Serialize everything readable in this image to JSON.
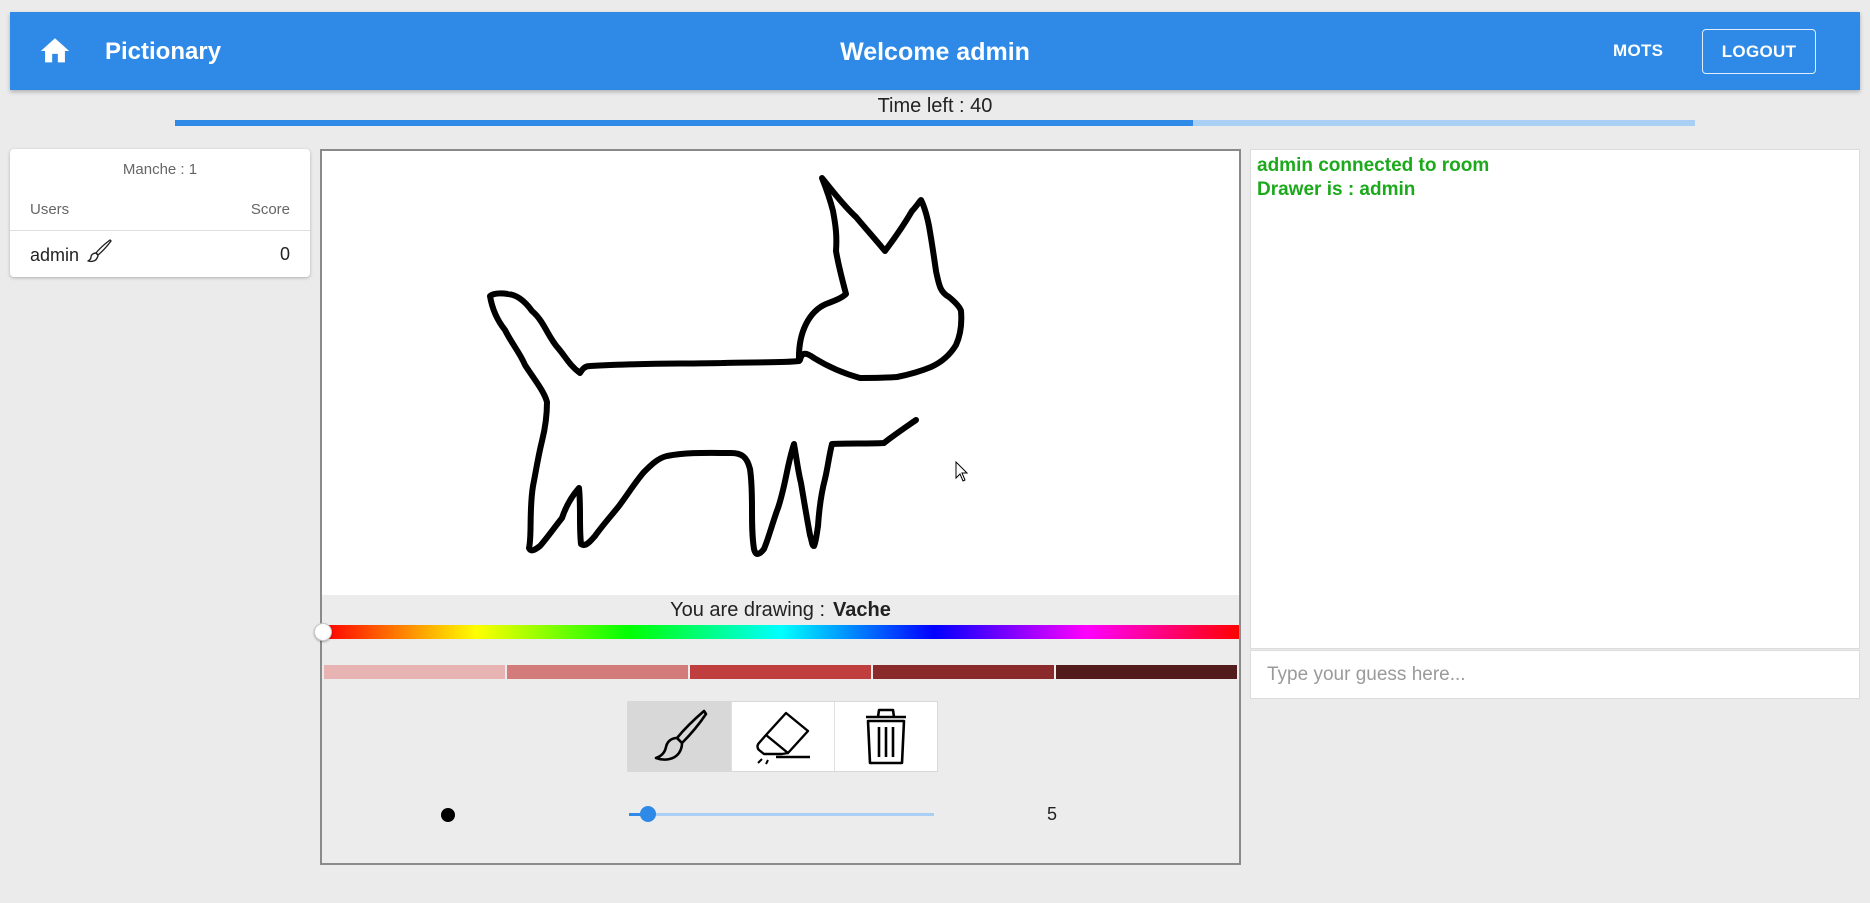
{
  "header": {
    "home_icon": "home-icon",
    "title": "Pictionary",
    "welcome": "Welcome admin",
    "mots_label": "MOTS",
    "logout_label": "LOGOUT",
    "color": "#2e8ae6"
  },
  "timer": {
    "label": "Time left : 40",
    "progress": 0.67
  },
  "scoreboard": {
    "round_label": "Manche : 1",
    "col_users": "Users",
    "col_score": "Score",
    "rows": [
      {
        "name": "admin",
        "score": "0",
        "is_drawer": true,
        "drawer_icon": "paintbrush-icon"
      }
    ]
  },
  "canvas": {
    "drawing_prefix": "You are drawing :",
    "word": "Vache",
    "hue_slider_value": 0,
    "shades": [
      "#e8b3b3",
      "#d37a7a",
      "#c13e3e",
      "#8a2a2a",
      "#531c1c"
    ],
    "tools": [
      {
        "name": "brush",
        "icon": "paintbrush-icon",
        "active": true
      },
      {
        "name": "eraser",
        "icon": "eraser-icon",
        "active": false
      },
      {
        "name": "clear",
        "icon": "trash-icon",
        "active": false
      }
    ],
    "brush_size": "5",
    "brush_size_fraction": 0.05
  },
  "chat": {
    "messages": [
      {
        "text": "admin connected to room",
        "color": "#1ca91c"
      },
      {
        "text": "Drawer is : admin",
        "color": "#1ca91c"
      }
    ],
    "input_placeholder": "Type your guess here..."
  }
}
